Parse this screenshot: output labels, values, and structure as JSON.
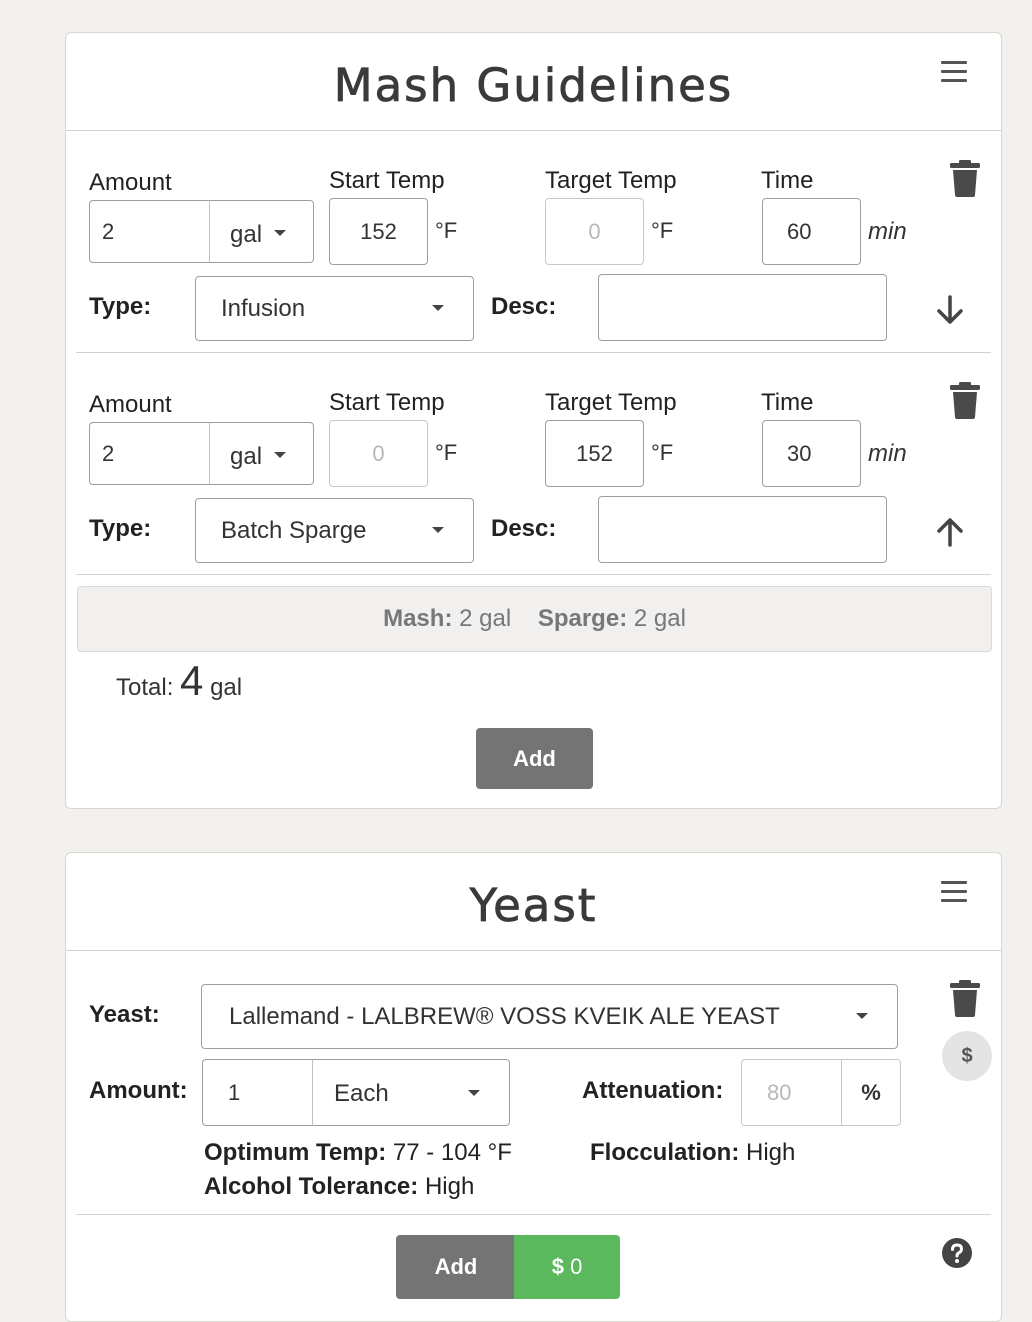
{
  "mash": {
    "title": "Mash Guidelines",
    "labels": {
      "amount": "Amount",
      "start_temp": "Start Temp",
      "target_temp": "Target Temp",
      "time": "Time",
      "type": "Type:",
      "desc": "Desc:",
      "deg_unit": "°F",
      "time_unit": "min"
    },
    "steps": [
      {
        "amount": "2",
        "amount_unit": "gal",
        "start_temp": "152",
        "target_temp_placeholder": "0",
        "time": "60",
        "type": "Infusion",
        "desc": "",
        "move_icon": "arrow-down-icon"
      },
      {
        "amount": "2",
        "amount_unit": "gal",
        "start_temp_placeholder": "0",
        "target_temp": "152",
        "time": "30",
        "type": "Batch Sparge",
        "desc": "",
        "move_icon": "arrow-up-icon"
      }
    ],
    "summary": {
      "mash_label": "Mash:",
      "mash_value": "2 gal",
      "sparge_label": "Sparge:",
      "sparge_value": "2 gal"
    },
    "total": {
      "label": "Total:",
      "value": "4",
      "unit": "gal"
    },
    "add_label": "Add"
  },
  "yeast": {
    "title": "Yeast",
    "labels": {
      "yeast": "Yeast:",
      "amount": "Amount:",
      "attenuation": "Attenuation:",
      "percent": "%",
      "optimum_temp": "Optimum Temp:",
      "flocculation": "Flocculation:",
      "alcohol_tolerance": "Alcohol Tolerance:"
    },
    "selected_yeast": "Lallemand - LALBREW® VOSS KVEIK ALE YEAST",
    "amount": "1",
    "amount_unit": "Each",
    "attenuation_placeholder": "80",
    "optimum_temp_value": "77 - 104 °F",
    "flocculation_value": "High",
    "alcohol_tolerance_value": "High",
    "price_icon_label": "$",
    "add_label": "Add",
    "cost_symbol": "$",
    "cost_value": "0"
  },
  "colors": {
    "accent_green": "#5cb85c",
    "button_grey": "#747474",
    "background": "#f3f1ee"
  }
}
